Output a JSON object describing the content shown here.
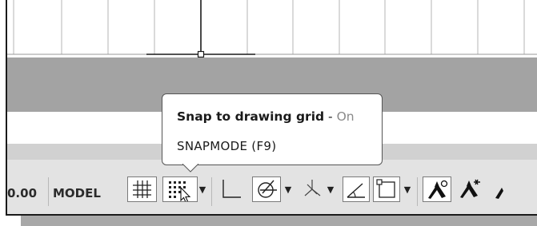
{
  "status_bar": {
    "coordinate_readout": "0.00",
    "space_label": "MODEL",
    "dropdown_glyph": "▼",
    "buttons": [
      {
        "name": "grid-display",
        "icon": "grid-icon",
        "active": true
      },
      {
        "name": "snap-mode",
        "icon": "snap-grid-icon",
        "active": true
      },
      {
        "name": "ortho-mode",
        "icon": "ortho-icon",
        "active": false
      },
      {
        "name": "polar-tracking",
        "icon": "polar-icon",
        "active": true
      },
      {
        "name": "isometric-drafting",
        "icon": "isodraft-icon",
        "active": false
      },
      {
        "name": "object-snap-tracking",
        "icon": "angle-icon",
        "active": true
      },
      {
        "name": "object-snap",
        "icon": "osnap-box-icon",
        "active": true
      },
      {
        "name": "annotation-visibility",
        "icon": "annotation-scale-icon",
        "active": true
      },
      {
        "name": "auto-scale",
        "icon": "auto-scale-icon",
        "active": false
      }
    ]
  },
  "tooltip": {
    "title": "Snap to drawing grid",
    "separator": " - ",
    "state": "On",
    "command": "SNAPMODE (F9)"
  },
  "colors": {
    "panel_gray": "#a3a3a3",
    "statusbar": "#e3e3e3",
    "grid_line": "#b0b0b0"
  }
}
